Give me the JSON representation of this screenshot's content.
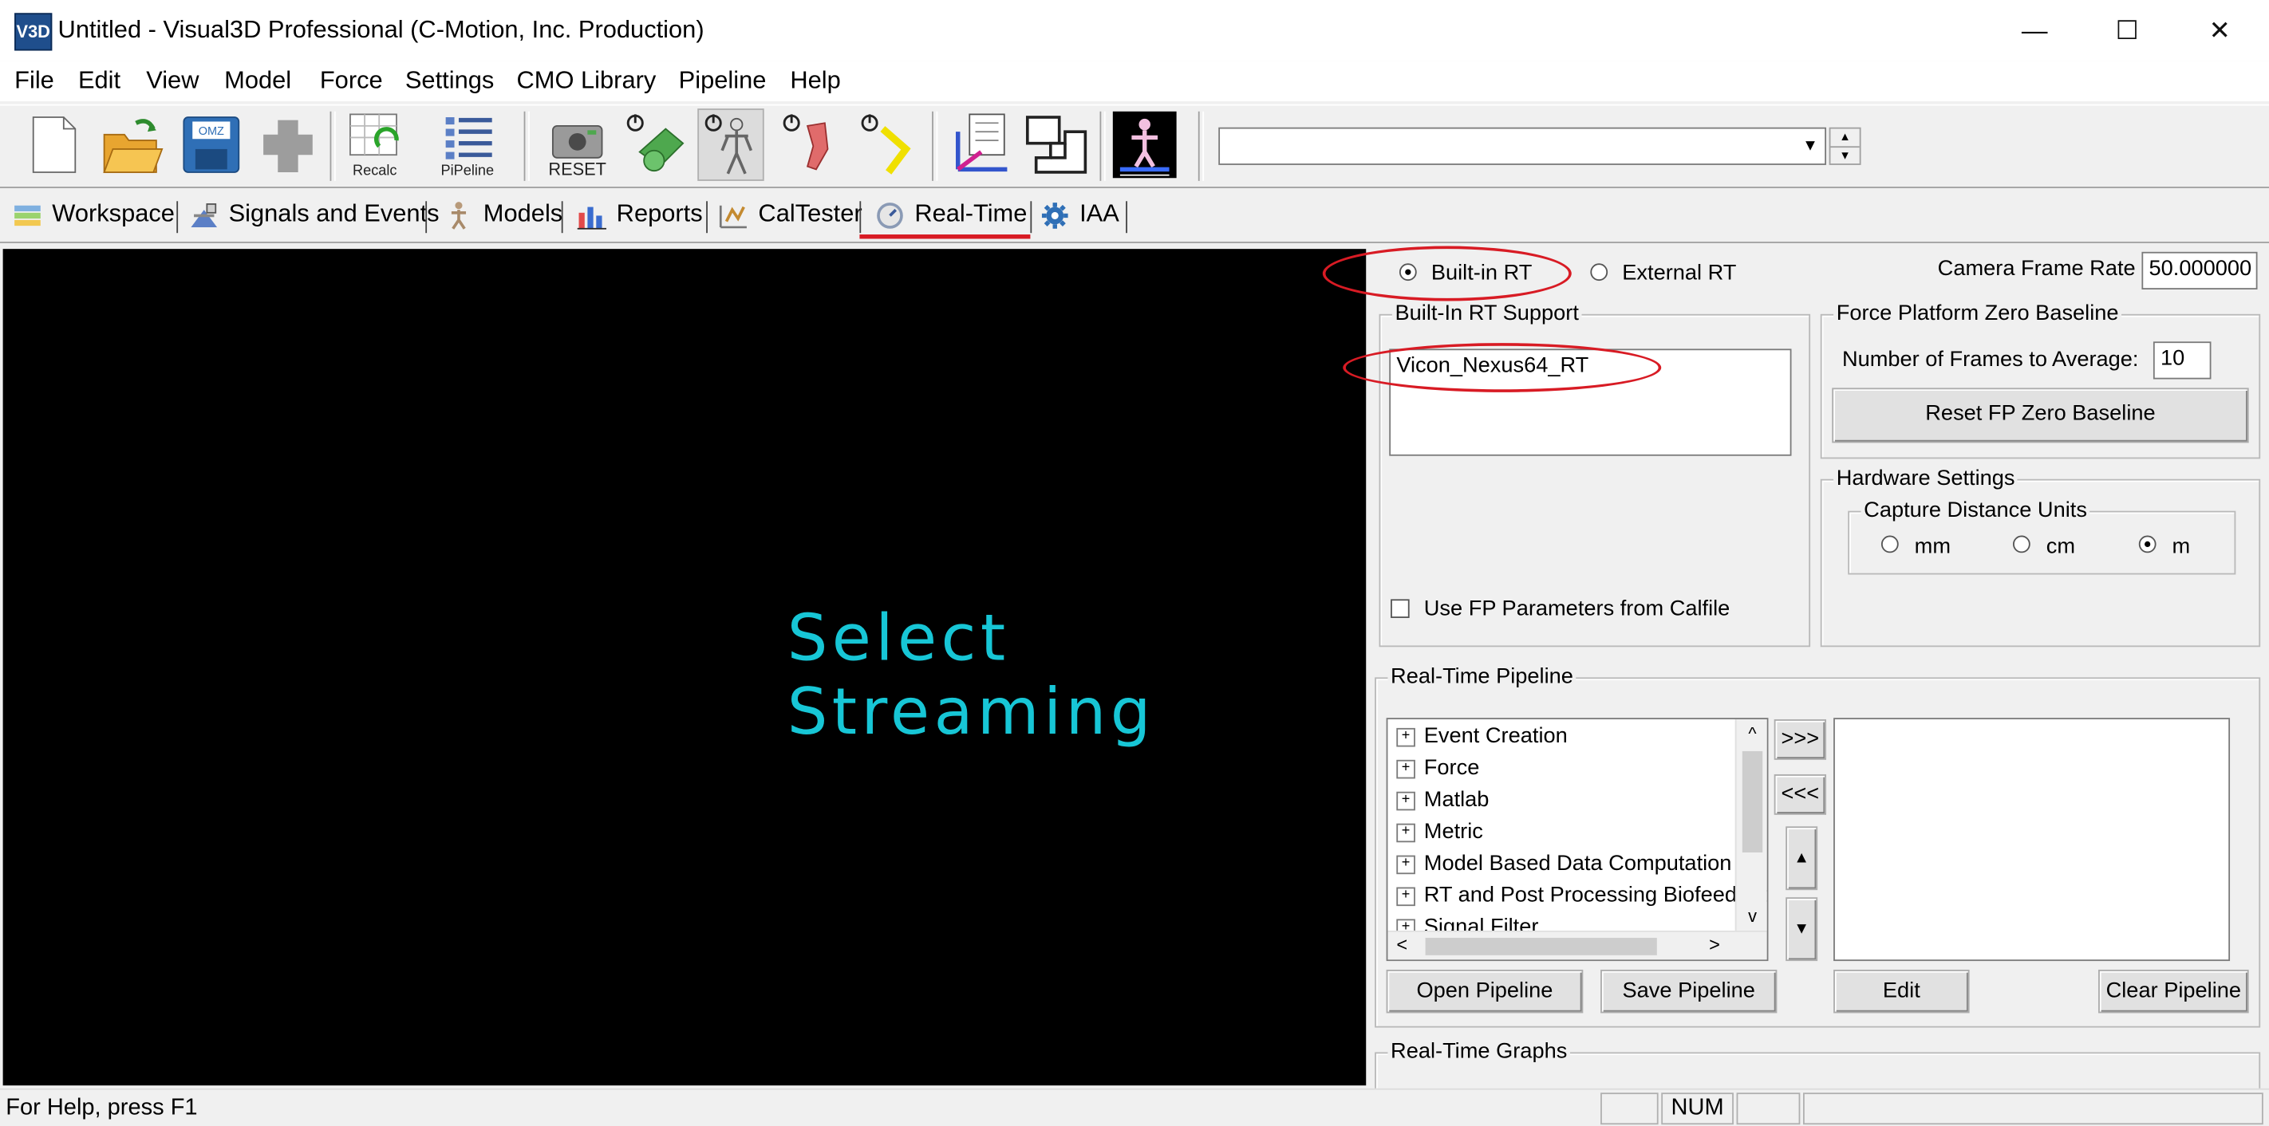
{
  "window": {
    "app_icon": "V3D",
    "title": "Untitled - Visual3D Professional (C-Motion, Inc. Production)",
    "minimize_glyph": "—",
    "maximize_glyph": "☐",
    "close_glyph": "✕"
  },
  "menu": [
    "File",
    "Edit",
    "View",
    "Model",
    "Force",
    "Settings",
    "CMO Library",
    "Pipeline",
    "Help"
  ],
  "toolbar": {
    "recalc_label": "Recalc",
    "pipeline_label": "PiPeline",
    "reset_label": "RESET",
    "omz_label": "OMZ",
    "combo_value": "",
    "combo_arrow": "▼",
    "spin_up": "▲",
    "spin_down": "▼"
  },
  "tabs": [
    "Workspace",
    "Signals and Events",
    "Models",
    "Reports",
    "CalTester",
    "Real-Time",
    "IAA"
  ],
  "viewport": {
    "text": "Select Streaming"
  },
  "rt": {
    "builtin_label": "Built-in RT",
    "external_label": "External RT",
    "camera_rate_label": "Camera Frame Rate",
    "camera_rate_value": "50.000000",
    "support_group": "Built-In RT Support",
    "support_items": [
      "Vicon_Nexus64_RT"
    ],
    "use_fp_label": "Use FP Parameters from Calfile",
    "fp_group": "Force Platform Zero Baseline",
    "frames_label": "Number of Frames to Average:",
    "frames_value": "10",
    "reset_fp_button": "Reset FP Zero Baseline",
    "hardware_group": "Hardware Settings",
    "capture_group": "Capture Distance Units",
    "unit_mm": "mm",
    "unit_cm": "cm",
    "unit_m": "m"
  },
  "pipeline": {
    "group": "Real-Time Pipeline",
    "tree": [
      "Event Creation",
      "Force",
      "Matlab",
      "Metric",
      "Model Based Data Computation",
      "RT and Post Processing Biofeedback",
      "Signal Filter"
    ],
    "add_button": ">>>",
    "remove_button": "<<<",
    "up_glyph": "▲",
    "down_glyph": "▼",
    "scroll_up": "^",
    "scroll_down": "v",
    "scroll_left": "<",
    "scroll_right": ">",
    "open_button": "Open Pipeline",
    "save_button": "Save Pipeline",
    "edit_button": "Edit",
    "clear_button": "Clear Pipeline"
  },
  "graphs": {
    "group": "Real-Time Graphs"
  },
  "status": {
    "help": "For Help, press F1",
    "num": "NUM"
  },
  "colors": {
    "viewport_bg": "#000000",
    "streaming_text": "#17c6d6",
    "annotation": "#d81b24"
  }
}
